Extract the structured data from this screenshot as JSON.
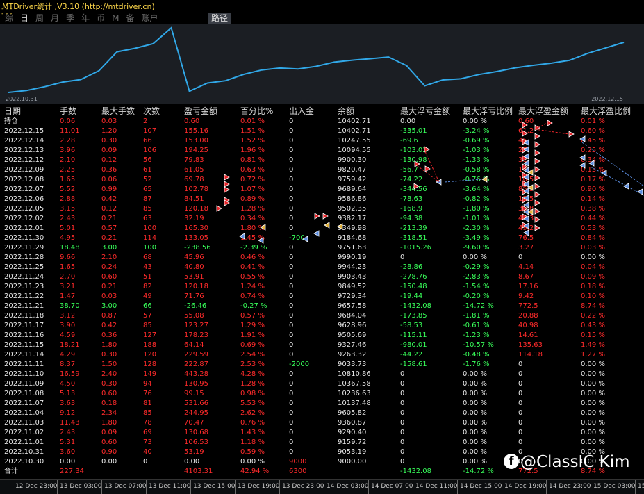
{
  "window": {
    "title": "MTDriver统计 ,V3.10 (http://mtdriver.cn)",
    "dashes": "- - -\n- - -"
  },
  "tabs": [
    "综",
    "日",
    "周",
    "月",
    "季",
    "年",
    "币",
    "M",
    "备",
    "账户"
  ],
  "active_tab": "日",
  "route_button": "路径",
  "equity_chart": {
    "start_label": "2022.10.31",
    "end_label": "2022.12.15",
    "line_color": "#31a8e8",
    "values": [
      9000.0,
      9053.19,
      9159.72,
      9290.4,
      9360.87,
      9605.82,
      10137.48,
      10236.63,
      10367.58,
      10810.86,
      9033.73,
      9263.32,
      9327.46,
      9505.69,
      9628.96,
      9684.04,
      9657.58,
      9729.34,
      9849.52,
      9903.43,
      9944.23,
      9990.19,
      9751.63,
      9184.68,
      9349.98,
      9382.17,
      9502.35,
      9586.86,
      9689.64,
      9759.42,
      9820.47,
      9900.3,
      10094.55,
      10247.55,
      10402.71
    ]
  },
  "columns": [
    "日期",
    "手数",
    "最大手数",
    "次数",
    "盈亏金额",
    "百分比%",
    "出入金",
    "余额",
    "最大浮亏金额",
    "最大浮亏比例",
    "最大浮盈金额",
    "最大浮盈比例"
  ],
  "rows": [
    [
      "持仓",
      "0.06",
      "0.03",
      "2",
      "0.60",
      "0.01 %",
      "0",
      "10402.71",
      "0.00",
      "0.00 %",
      "0.60",
      "0.01 %"
    ],
    [
      "2022.12.15",
      "11.01",
      "1.20",
      "107",
      "155.16",
      "1.51 %",
      "0",
      "10402.71",
      "-335.01",
      "-3.24 %",
      "61.2",
      "0.60 %"
    ],
    [
      "2022.12.14",
      "2.28",
      "0.30",
      "66",
      "153.00",
      "1.52 %",
      "0",
      "10247.55",
      "-69.6",
      "-0.69 %",
      "45",
      "0.45 %"
    ],
    [
      "2022.12.13",
      "3.96",
      "0.09",
      "106",
      "194.25",
      "1.96 %",
      "0",
      "10094.55",
      "-103.02",
      "-1.03 %",
      "27",
      "0.25 %"
    ],
    [
      "2022.12.12",
      "2.10",
      "0.12",
      "56",
      "79.83",
      "0.81 %",
      "0",
      "9900.30",
      "-130.98",
      "-1.33 %",
      "31",
      "0.34 %"
    ],
    [
      "2022.12.09",
      "2.25",
      "0.36",
      "61",
      "61.05",
      "0.63 %",
      "0",
      "9820.47",
      "-56.7",
      "-0.58 %",
      "14",
      "0.13 %"
    ],
    [
      "2022.12.08",
      "1.65",
      "0.06",
      "52",
      "69.78",
      "0.72 %",
      "0",
      "9759.42",
      "-74.22",
      "-0.76 %",
      "16.5",
      "0.17 %"
    ],
    [
      "2022.12.07",
      "5.52",
      "0.99",
      "65",
      "102.78",
      "1.07 %",
      "0",
      "9689.64",
      "-344.56",
      "-3.64 %",
      "85.5",
      "0.90 %"
    ],
    [
      "2022.12.06",
      "2.88",
      "0.42",
      "87",
      "84.51",
      "0.89 %",
      "0",
      "9586.86",
      "-78.63",
      "-0.82 %",
      "13.5",
      "0.14 %"
    ],
    [
      "2022.12.05",
      "3.15",
      "0.12",
      "85",
      "120.18",
      "1.28 %",
      "0",
      "9502.35",
      "-168.9",
      "-1.80 %",
      "35.8",
      "0.38 %"
    ],
    [
      "2022.12.02",
      "2.43",
      "0.21",
      "63",
      "32.19",
      "0.34 %",
      "0",
      "9382.17",
      "-94.38",
      "-1.01 %",
      "41.3",
      "0.44 %"
    ],
    [
      "2022.12.01",
      "5.01",
      "0.57",
      "100",
      "165.30",
      "1.80 %",
      "0",
      "9349.98",
      "-213.39",
      "-2.30 %",
      "49.2",
      "0.53 %"
    ],
    [
      "2022.11.30",
      "4.95",
      "0.21",
      "114",
      "133.05",
      "1.45 %",
      "-700",
      "9184.68",
      "-318.51",
      "-3.49 %",
      "76.5",
      "0.84 %"
    ],
    [
      "2022.11.29",
      "18.48",
      "3.00",
      "100",
      "-238.56",
      "-2.39 %",
      "0",
      "9751.63",
      "-1015.26",
      "-9.60 %",
      "3.27",
      "0.03 %"
    ],
    [
      "2022.11.28",
      "9.66",
      "2.10",
      "68",
      "45.96",
      "0.46 %",
      "0",
      "9990.19",
      "0",
      "0.00 %",
      "0",
      "0.00 %"
    ],
    [
      "2022.11.25",
      "1.65",
      "0.24",
      "43",
      "40.80",
      "0.41 %",
      "0",
      "9944.23",
      "-28.86",
      "-0.29 %",
      "4.14",
      "0.04 %"
    ],
    [
      "2022.11.24",
      "2.70",
      "0.60",
      "51",
      "53.91",
      "0.55 %",
      "0",
      "9903.43",
      "-278.76",
      "-2.83 %",
      "8.67",
      "0.09 %"
    ],
    [
      "2022.11.23",
      "3.21",
      "0.21",
      "82",
      "120.18",
      "1.24 %",
      "0",
      "9849.52",
      "-150.48",
      "-1.54 %",
      "17.16",
      "0.18 %"
    ],
    [
      "2022.11.22",
      "1.47",
      "0.03",
      "49",
      "71.76",
      "0.74 %",
      "0",
      "9729.34",
      "-19.44",
      "-0.20 %",
      "9.42",
      "0.10 %"
    ],
    [
      "2022.11.21",
      "38.70",
      "3.00",
      "66",
      "-26.46",
      "-0.27 %",
      "0",
      "9657.58",
      "-1432.08",
      "-14.72 %",
      "772.5",
      "8.74 %"
    ],
    [
      "2022.11.18",
      "3.12",
      "0.87",
      "57",
      "55.08",
      "0.57 %",
      "0",
      "9684.04",
      "-173.85",
      "-1.81 %",
      "20.88",
      "0.22 %"
    ],
    [
      "2022.11.17",
      "3.90",
      "0.42",
      "85",
      "123.27",
      "1.29 %",
      "0",
      "9628.96",
      "-58.53",
      "-0.61 %",
      "40.98",
      "0.43 %"
    ],
    [
      "2022.11.16",
      "4.59",
      "0.36",
      "127",
      "178.23",
      "1.91 %",
      "0",
      "9505.69",
      "-115.11",
      "-1.23 %",
      "14.61",
      "0.15 %"
    ],
    [
      "2022.11.15",
      "18.21",
      "1.80",
      "188",
      "64.14",
      "0.69 %",
      "0",
      "9327.46",
      "-980.01",
      "-10.57 %",
      "135.63",
      "1.49 %"
    ],
    [
      "2022.11.14",
      "4.29",
      "0.30",
      "120",
      "229.59",
      "2.54 %",
      "0",
      "9263.32",
      "-44.22",
      "-0.48 %",
      "114.18",
      "1.27 %"
    ],
    [
      "2022.11.11",
      "8.37",
      "1.50",
      "128",
      "222.87",
      "2.53 %",
      "-2000",
      "9033.73",
      "-158.61",
      "-1.76 %",
      "0",
      "0.00 %"
    ],
    [
      "2022.11.10",
      "16.59",
      "2.40",
      "149",
      "443.28",
      "4.28 %",
      "0",
      "10810.86",
      "0",
      "0.00 %",
      "0",
      "0.00 %"
    ],
    [
      "2022.11.09",
      "4.50",
      "0.30",
      "94",
      "130.95",
      "1.28 %",
      "0",
      "10367.58",
      "0",
      "0.00 %",
      "0",
      "0.00 %"
    ],
    [
      "2022.11.08",
      "5.13",
      "0.60",
      "76",
      "99.15",
      "0.98 %",
      "0",
      "10236.63",
      "0",
      "0.00 %",
      "0",
      "0.00 %"
    ],
    [
      "2022.11.07",
      "3.63",
      "0.18",
      "81",
      "531.66",
      "5.53 %",
      "0",
      "10137.48",
      "0",
      "0.00 %",
      "0",
      "0.00 %"
    ],
    [
      "2022.11.04",
      "9.12",
      "2.34",
      "85",
      "244.95",
      "2.62 %",
      "0",
      "9605.82",
      "0",
      "0.00 %",
      "0",
      "0.00 %"
    ],
    [
      "2022.11.03",
      "11.43",
      "1.80",
      "78",
      "70.47",
      "0.76 %",
      "0",
      "9360.87",
      "0",
      "0.00 %",
      "0",
      "0.00 %"
    ],
    [
      "2022.11.02",
      "2.43",
      "0.09",
      "69",
      "130.68",
      "1.43 %",
      "0",
      "9290.40",
      "0",
      "0.00 %",
      "0",
      "0.00 %"
    ],
    [
      "2022.11.01",
      "5.31",
      "0.60",
      "73",
      "106.53",
      "1.18 %",
      "0",
      "9159.72",
      "0",
      "0.00 %",
      "0",
      "0.00 %"
    ],
    [
      "2022.10.31",
      "3.60",
      "0.90",
      "40",
      "53.19",
      "0.59 %",
      "0",
      "9053.19",
      "0",
      "0.00 %",
      "0",
      "0.00 %"
    ],
    [
      "2022.10.30",
      "0.00",
      "0.00",
      "0",
      "0.00",
      "0.00 %",
      "9000",
      "9000.00",
      "0",
      "0.00 %",
      "0",
      "0.00 %"
    ]
  ],
  "total": [
    "合计",
    "227.34",
    "",
    "",
    "4103.31",
    "42.94 %",
    "6300",
    "",
    "-1432.08",
    "-14.72 %",
    "772.5",
    "8.74 %"
  ],
  "time_axis": [
    "12 Dec 23:00",
    "13 Dec 03:00",
    "13 Dec 07:00",
    "13 Dec 11:00",
    "13 Dec 15:00",
    "13 Dec 19:00",
    "13 Dec 23:00",
    "14 Dec 03:00",
    "14 Dec 07:00",
    "14 Dec 11:00",
    "14 Dec 15:00",
    "14 Dec 19:00",
    "14 Dec 23:00",
    "15 Dec 03:00",
    "15 Dec 07:00"
  ],
  "watermark": {
    "logo": "f",
    "text": "@ClassIC Kim"
  },
  "colors": {
    "positive": "#ff2b2b",
    "negative": "#38ff5a",
    "neutral": "#e6e6e6",
    "accent": "#ffd84a",
    "panel": "#1b1e23"
  }
}
